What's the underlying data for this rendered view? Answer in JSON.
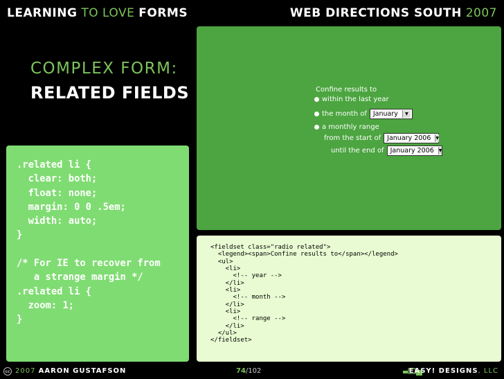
{
  "header": {
    "left": [
      "LEARNING",
      "TO LOVE",
      "FORMS"
    ],
    "right": [
      "WEB DIRECTIONS SOUTH",
      "2007"
    ]
  },
  "title": {
    "line1": "COMPLEX FORM:",
    "line2": "RELATED FIELDS"
  },
  "form_demo": {
    "legend": "Confine results to",
    "opt1": "within the last year",
    "opt2": "the month of",
    "opt2_select": "January",
    "opt3": "a monthly range",
    "from_label": "from the start of",
    "from_select": "January 2006",
    "until_label": "until the end of",
    "until_select": "January 2006"
  },
  "css_code": ".related li {\n  clear: both;\n  float: none;\n  margin: 0 0 .5em;\n  width: auto;\n}\n\n/* For IE to recover from\n   a strange margin */\n.related li {\n  zoom: 1;\n}",
  "html_code": "<fieldset class=\"radio related\">\n  <legend><span>Confine results to</span></legend>\n  <ul>\n    <li>\n      <!-- year -->\n    </li>\n    <li>\n      <!-- month -->\n    </li>\n    <li>\n      <!-- range -->\n    </li>\n  </ul>\n</fieldset>",
  "footer": {
    "year": "2007",
    "author": "AARON GUSTAFSON",
    "page_current": "74",
    "page_sep": "/",
    "page_total": "102",
    "company": "EASY! DESIGNS",
    "company_suffix": ", LLC"
  },
  "colors": {
    "accent": "#7dc45b",
    "background": "#000000",
    "screenshot_green": "#4ca540",
    "css_box": "#7fdc72",
    "html_box": "#e8fbd2"
  }
}
